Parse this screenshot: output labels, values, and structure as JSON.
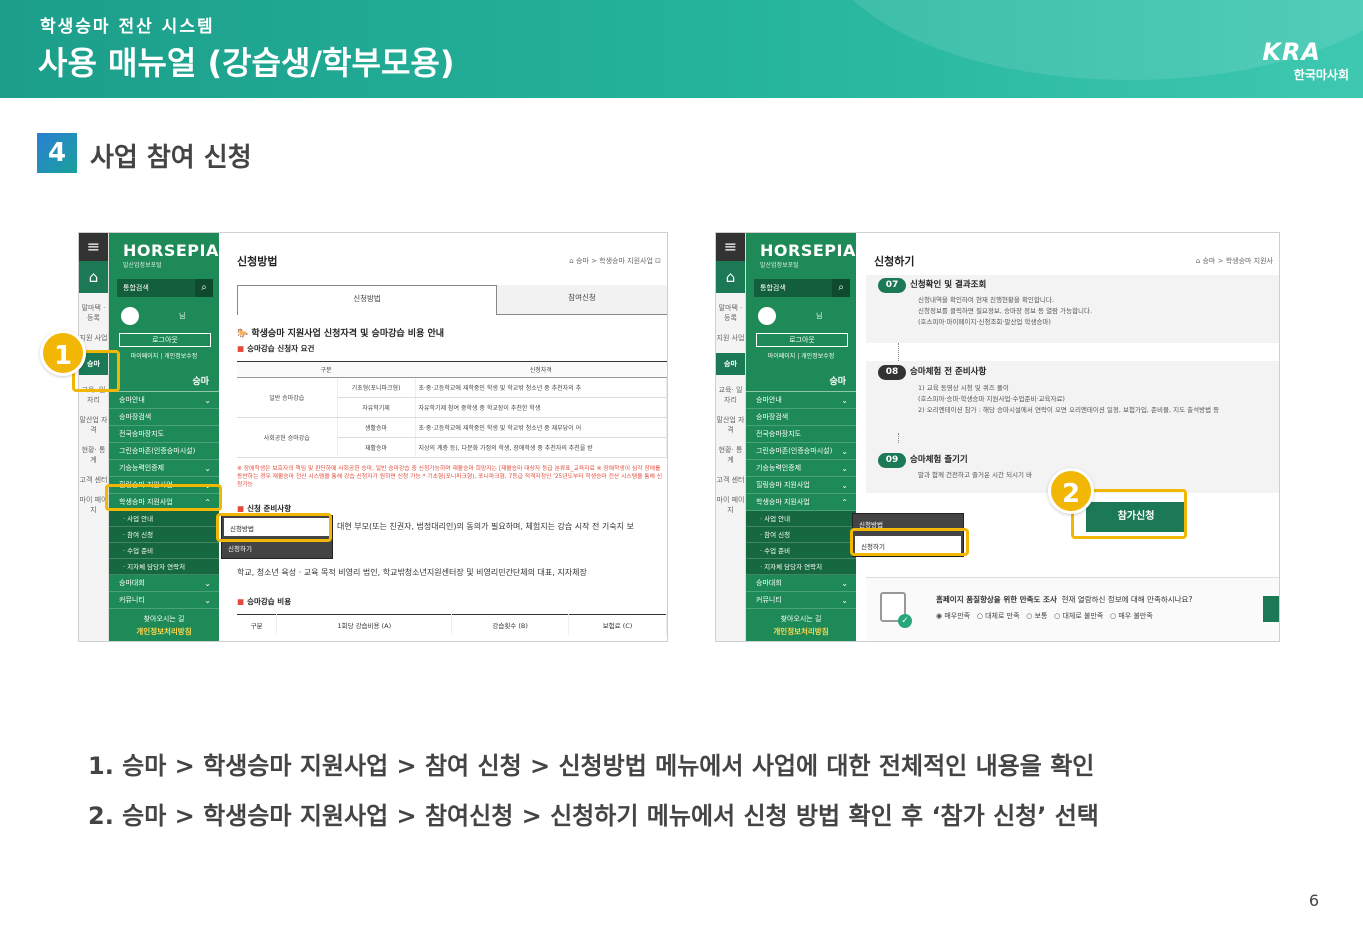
{
  "header": {
    "subtitle": "학생승마 전산 시스템",
    "title": "사용 매뉴얼 (강습생/학부모용)",
    "logo_mark": "KRA",
    "logo_text": "한국마사회"
  },
  "section": {
    "number": "4",
    "title": "사업 참여 신청"
  },
  "left_shot": {
    "brand": "HORSEPIA",
    "brand_sub": "말산업정보포털",
    "search_label": "통합검색",
    "profile_suffix": "님",
    "logout": "로그아웃",
    "mylinks": "마이페이지 | 개인정보수정",
    "nav_icons": [
      "말마택 ·등록",
      "지원 사업",
      "승마",
      "교육· 일자리",
      "말산업 자격",
      "현황· 통계",
      "고객 센터",
      "마이 페이지"
    ],
    "group": "승마",
    "menu": [
      {
        "label": "승마안내",
        "chev": "⌄"
      },
      {
        "label": "승마장검색",
        "chev": ""
      },
      {
        "label": "전국승마장지도",
        "chev": ""
      },
      {
        "label": "그린승마존(인증승마시설)",
        "chev": ""
      },
      {
        "label": "기승능력인증제",
        "chev": "⌄"
      },
      {
        "label": "힐링승마 지원사업",
        "chev": "⌄"
      },
      {
        "label": "학생승마 지원사업",
        "chev": "⌃"
      }
    ],
    "submenu": [
      "· 사업 안내",
      "· 참여 신청",
      "· 수업 준비",
      "· 지자체 담당자 연락처"
    ],
    "menu_after": [
      {
        "label": "승마대회",
        "chev": "⌄"
      },
      {
        "label": "커뮤니티",
        "chev": "⌄"
      }
    ],
    "foot_line1": "찾아오시는 길",
    "foot_line2": "개인정보처리방침",
    "page_title": "신청방법",
    "breadcrumb": "⌂ 승마 > 학생승마 지원사업 ⊡",
    "tab1": "신청방법",
    "tab2": "참여신청",
    "heading": "학생승마 지원사업 신청자격 및 승마강습 비용 안내",
    "sub_heading": "승마강습 신청자 요건",
    "table_headers": [
      "구분",
      "",
      "신청자격"
    ],
    "table_rows": [
      {
        "group": "일반 승마강습",
        "type": "기초형(포니파크형)",
        "desc": "초·중·고등학교에 재학중인 학생 및 학교밖 청소년 중 추천자의 추"
      },
      {
        "group": "",
        "type": "자유학기제",
        "desc": "자유학기제 참여 중학생 중 학교장이 추천한 학생"
      },
      {
        "group": "사회공헌 승마강습",
        "type": "생활승마",
        "desc": "초·중·고등학교에 재학중인 학생 및 학교밖 청소년 중 재부당이 어"
      },
      {
        "group": "",
        "type": "재활승마",
        "desc": "지상의 계층 등), 다문화 가정의 학생, 장애학생 중 추천자의 추천을 받"
      }
    ],
    "red_note": "※ 장애학생은 보호자의 책임 및 판단하에 사회공헌 승마, 일반 승마강습 중 신청가능하며 재활승마 희망자는 [재활승마 대상자 등급 분류표_교육자료 ※ 장애학생이 심각 장애를 동반하는 경우 재활승마 전산 시스템을 통해 강습 신청자가 원하면 신청 가능 * 기초형(포니파크형), 포니파크형, 7등급 적격자정인 '25년도부터 학생승마 전산 시스템을 통해 신청가능",
    "prep_heading": "신청 준비사항",
    "prep_text": "대현 부모(또는 친권자, 법정대리인)의 동의가 필요하며, 체험지는 강습 시작 전 기숙지 보",
    "prep_text2": "학교, 청소년 육성 · 교육 목적 비영리 법인, 학교밖청소년지원센터장 및 비영리민간단체의 대표, 지자체장",
    "cost_heading": "승마강습 비용",
    "cost_headers": [
      "구분",
      "1회당 강습비용 (A)",
      "강습횟수 (B)",
      "보험료 (C)"
    ],
    "popup": [
      "신청방법",
      "신청하기"
    ]
  },
  "right_shot": {
    "brand": "HORSEPIA",
    "brand_sub": "말산업정보포털",
    "search_label": "통합검색",
    "profile_suffix": "님",
    "logout": "로그아웃",
    "mylinks": "마이페이지 | 개인정보수정",
    "nav_icons": [
      "말마택 ·등록",
      "지원 사업",
      "승마",
      "교육· 일자리",
      "말산업 자격",
      "현황· 통계",
      "고객 센터",
      "마이 페이지"
    ],
    "group": "승마",
    "menu": [
      {
        "label": "승마안내",
        "chev": "⌄"
      },
      {
        "label": "승마장검색",
        "chev": ""
      },
      {
        "label": "전국승마장지도",
        "chev": ""
      },
      {
        "label": "그린승마존(인증승마시설)",
        "chev": "⌄"
      },
      {
        "label": "기승능력인증제",
        "chev": "⌄"
      },
      {
        "label": "힐링승마 지원사업",
        "chev": "⌄"
      },
      {
        "label": "학생승마 지원사업",
        "chev": "⌃"
      }
    ],
    "submenu": [
      "· 사업 안내",
      "· 참여 신청",
      "· 수업 준비",
      "· 지자체 담당자 연락처"
    ],
    "menu_after": [
      {
        "label": "승마대회",
        "chev": "⌄"
      },
      {
        "label": "커뮤니티",
        "chev": "⌄"
      }
    ],
    "foot_line1": "찾아오시는 길",
    "foot_line2": "개인정보처리방침",
    "page_title": "신청하기",
    "breadcrumb": "⌂ 승마 > 학생승마 지원사",
    "steps": [
      {
        "num": "07",
        "title": "신청확인 및 결과조회",
        "lines": [
          "신청내역을 확인하여 현재 진행현황을 확인합니다.",
          "신청정보를 클릭하면 필요정보, 승마장 정보 등 열람 가능합니다.",
          "(호스피아·마이페이지·신청조회·말산업 학생승마)"
        ]
      },
      {
        "num": "08",
        "title": "승마체험 전 준비사항",
        "lines": [
          "1) 교육 동영상 시청 및 퀴즈 풀이",
          "(호스피아·승마·학생승마 지원사업·수업준비·교육자료)",
          "2) 오리엔테이션 참가 : 해당 승마시설에서 연락이 오면 오리엔테이션 일정, 보험가입, 준비물, 지도 출석방법 등"
        ]
      },
      {
        "num": "09",
        "title": "승마체험 즐기기",
        "lines": [
          "말과 함께 건전하고 즐거운 시간 되시기 바"
        ]
      }
    ],
    "apply_button": "참가신청",
    "popup": [
      "신청방법",
      "신청하기"
    ],
    "survey_question": "홈페이지 품질향상을 위한 만족도 조사",
    "survey_question2": "현재 열람하신 정보에 대해 만족하시나요?",
    "survey_options": [
      "◉ 매우만족",
      "○ 대체로 만족",
      "○ 보통",
      "○ 대체로 불만족",
      "○ 매우 불만족"
    ]
  },
  "badges": [
    "1",
    "2"
  ],
  "descriptions": [
    "1. 승마 > 학생승마 지원사업 > 참여 신청 > 신청방법 메뉴에서 사업에 대한 전체적인 내용을 확인",
    "2. 승마 > 학생승마 지원사업 > 참여신청 > 신청하기 메뉴에서 신청 방법 확인 후 ‘참가 신청’ 선택"
  ],
  "page_number": "6",
  "colors": {
    "brand_green": "#1b7a55",
    "header_teal": "#25b49c",
    "highlight": "#f2b705"
  }
}
